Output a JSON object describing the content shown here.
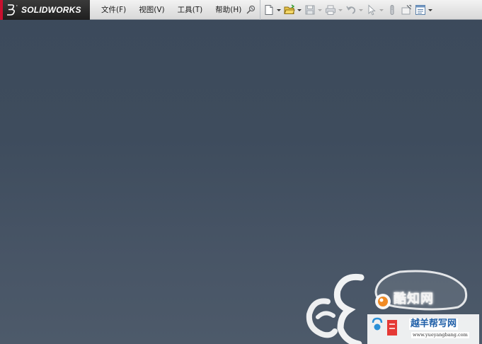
{
  "app": {
    "brand": "SOLIDWORKS",
    "brand_mark": "3DS"
  },
  "menu": {
    "items": [
      {
        "label": "文件(F)",
        "name": "file"
      },
      {
        "label": "视图(V)",
        "name": "view"
      },
      {
        "label": "工具(T)",
        "name": "tools"
      },
      {
        "label": "帮助(H)",
        "name": "help"
      }
    ]
  },
  "toolbar": {
    "icons": [
      "pin-icon",
      "new-document-icon",
      "open-folder-icon",
      "save-icon",
      "print-icon",
      "undo-icon",
      "select-pointer-icon",
      "rebuild-icon",
      "file-properties-icon",
      "options-icon"
    ]
  },
  "watermark": {
    "main_text": "酷知网",
    "site_text": "越羊帮写网",
    "url_text": "www.yueyangbang.com"
  },
  "colors": {
    "workspace_top": "#3c4a5b",
    "workspace_bottom": "#4d5a6a",
    "brand_red": "#c8102e",
    "menu_bar": "#e4e4e4"
  }
}
